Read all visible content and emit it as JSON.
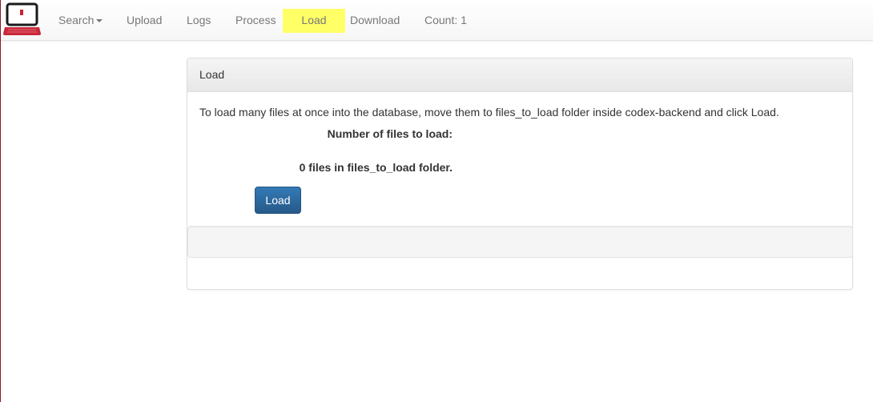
{
  "nav": {
    "logo_icon": "laptop-logo-icon",
    "items": [
      {
        "label": "Search",
        "has_dropdown": true
      },
      {
        "label": "Upload"
      },
      {
        "label": "Logs"
      },
      {
        "label": "Process"
      },
      {
        "label": "Load",
        "active": true
      },
      {
        "label": "Download"
      },
      {
        "label": "Count: 1"
      }
    ],
    "active_highlight_color": "#ffff66"
  },
  "panel": {
    "title": "Load",
    "description": "To load many files at once into the database, move them to files_to_load folder inside codex-backend and click Load.",
    "files_label": "Number of files to load:",
    "files_status": "0 files in files_to_load folder.",
    "load_button": "Load"
  },
  "colors": {
    "primary_button": "#337ab7",
    "left_border": "#8a1a2a"
  }
}
